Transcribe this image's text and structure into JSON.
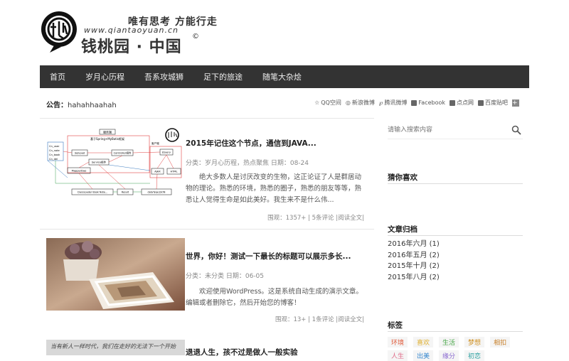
{
  "header": {
    "slogan": "唯有思考 方能行走",
    "url": "www.qiantaoyuan.cn",
    "name": "钱桃园 · 中国",
    "copyright": "©"
  },
  "nav": {
    "items": [
      {
        "label": "首页"
      },
      {
        "label": "岁月心历程"
      },
      {
        "label": "吾系攻城狮"
      },
      {
        "label": "足下的旅途"
      },
      {
        "label": "随笔大杂烩"
      }
    ]
  },
  "notice": {
    "label": "公告：",
    "text": "hahahhaahah"
  },
  "share": {
    "items": [
      {
        "label": "QQ空间",
        "icon": "star-icon"
      },
      {
        "label": "新浪微博",
        "icon": "weibo-icon"
      },
      {
        "label": "腾讯微博",
        "icon": "tencent-weibo-icon"
      },
      {
        "label": "Facebook",
        "icon": "facebook-icon"
      },
      {
        "label": "点点网",
        "icon": "diandian-icon"
      },
      {
        "label": "百度贴吧",
        "icon": "tieba-icon"
      }
    ],
    "more_icon": "plus-icon"
  },
  "posts": [
    {
      "title": "2015年记住这个节点，通信到JAVA...",
      "meta": "分类：岁月心历程，热点聚焦  日期：08-24",
      "excerpt": "绝大多数人是讨厌改变的生物，这正论证了人是群居动物的理论。熟悉的环境，熟悉的圈子，熟悉的朋友等等，熟悉让人觉得生命是如此美好。我生来不是什么伟...",
      "stats": "围观：1357+ | 5条评论  |阅读全文|",
      "diagram": {
        "top": "服务端",
        "sub": "基于Spring+MyBatis框架",
        "list": [
          "Cn_user",
          "Cn_note",
          "Cn_book",
          "Cn_del"
        ],
        "boxes": [
          "SqlLoad",
          "Controller组件",
          "Service组件",
          "MapperDao",
          "JQuery",
          "AJAX",
          "HTML"
        ],
        "client": "客户端",
        "bottom": [
          "ClassLoader Book Note...",
          "Result",
          "dataType:JSON"
        ]
      }
    },
    {
      "title": "世界，你好！测试一下最长的标题可以展示多长...",
      "meta": "分类：未分类  日期：06-05",
      "excerpt": "欢迎使用WordPress。这是系统自动生成的演示文章。编辑或者删除它，然后开始您的博客！",
      "stats": "围观：13+ | 1条评论  |阅读全文|"
    },
    {
      "title": "退退人生，孩不过是做人一般实验",
      "thumb_text": "当有新人一样时代，我们在走好的无法下一个开始"
    }
  ],
  "sidebar": {
    "search_placeholder": "请输入搜索内容",
    "guess_title": "猜你喜欢",
    "archive_title": "文章归档",
    "archives": [
      "2016年六月 (1)",
      "2016年五月 (2)",
      "2015年十月 (2)",
      "2015年八月 (2)"
    ],
    "tags_title": "标签",
    "tags": [
      {
        "label": "环境",
        "color": "#e05a3a"
      },
      {
        "label": "喜欢",
        "color": "#e0b030"
      },
      {
        "label": "生活",
        "color": "#4aa84a"
      },
      {
        "label": "梦想",
        "color": "#d09020"
      },
      {
        "label": "相扣",
        "color": "#c8802a"
      },
      {
        "label": "人生",
        "color": "#e06c8a"
      },
      {
        "label": "出美",
        "color": "#3a8ad0"
      },
      {
        "label": "缘分",
        "color": "#8a6ad0"
      },
      {
        "label": "初恋",
        "color": "#2aa0a0"
      }
    ]
  },
  "colors": {
    "nav_bg": "#333333",
    "link": "#222222"
  }
}
